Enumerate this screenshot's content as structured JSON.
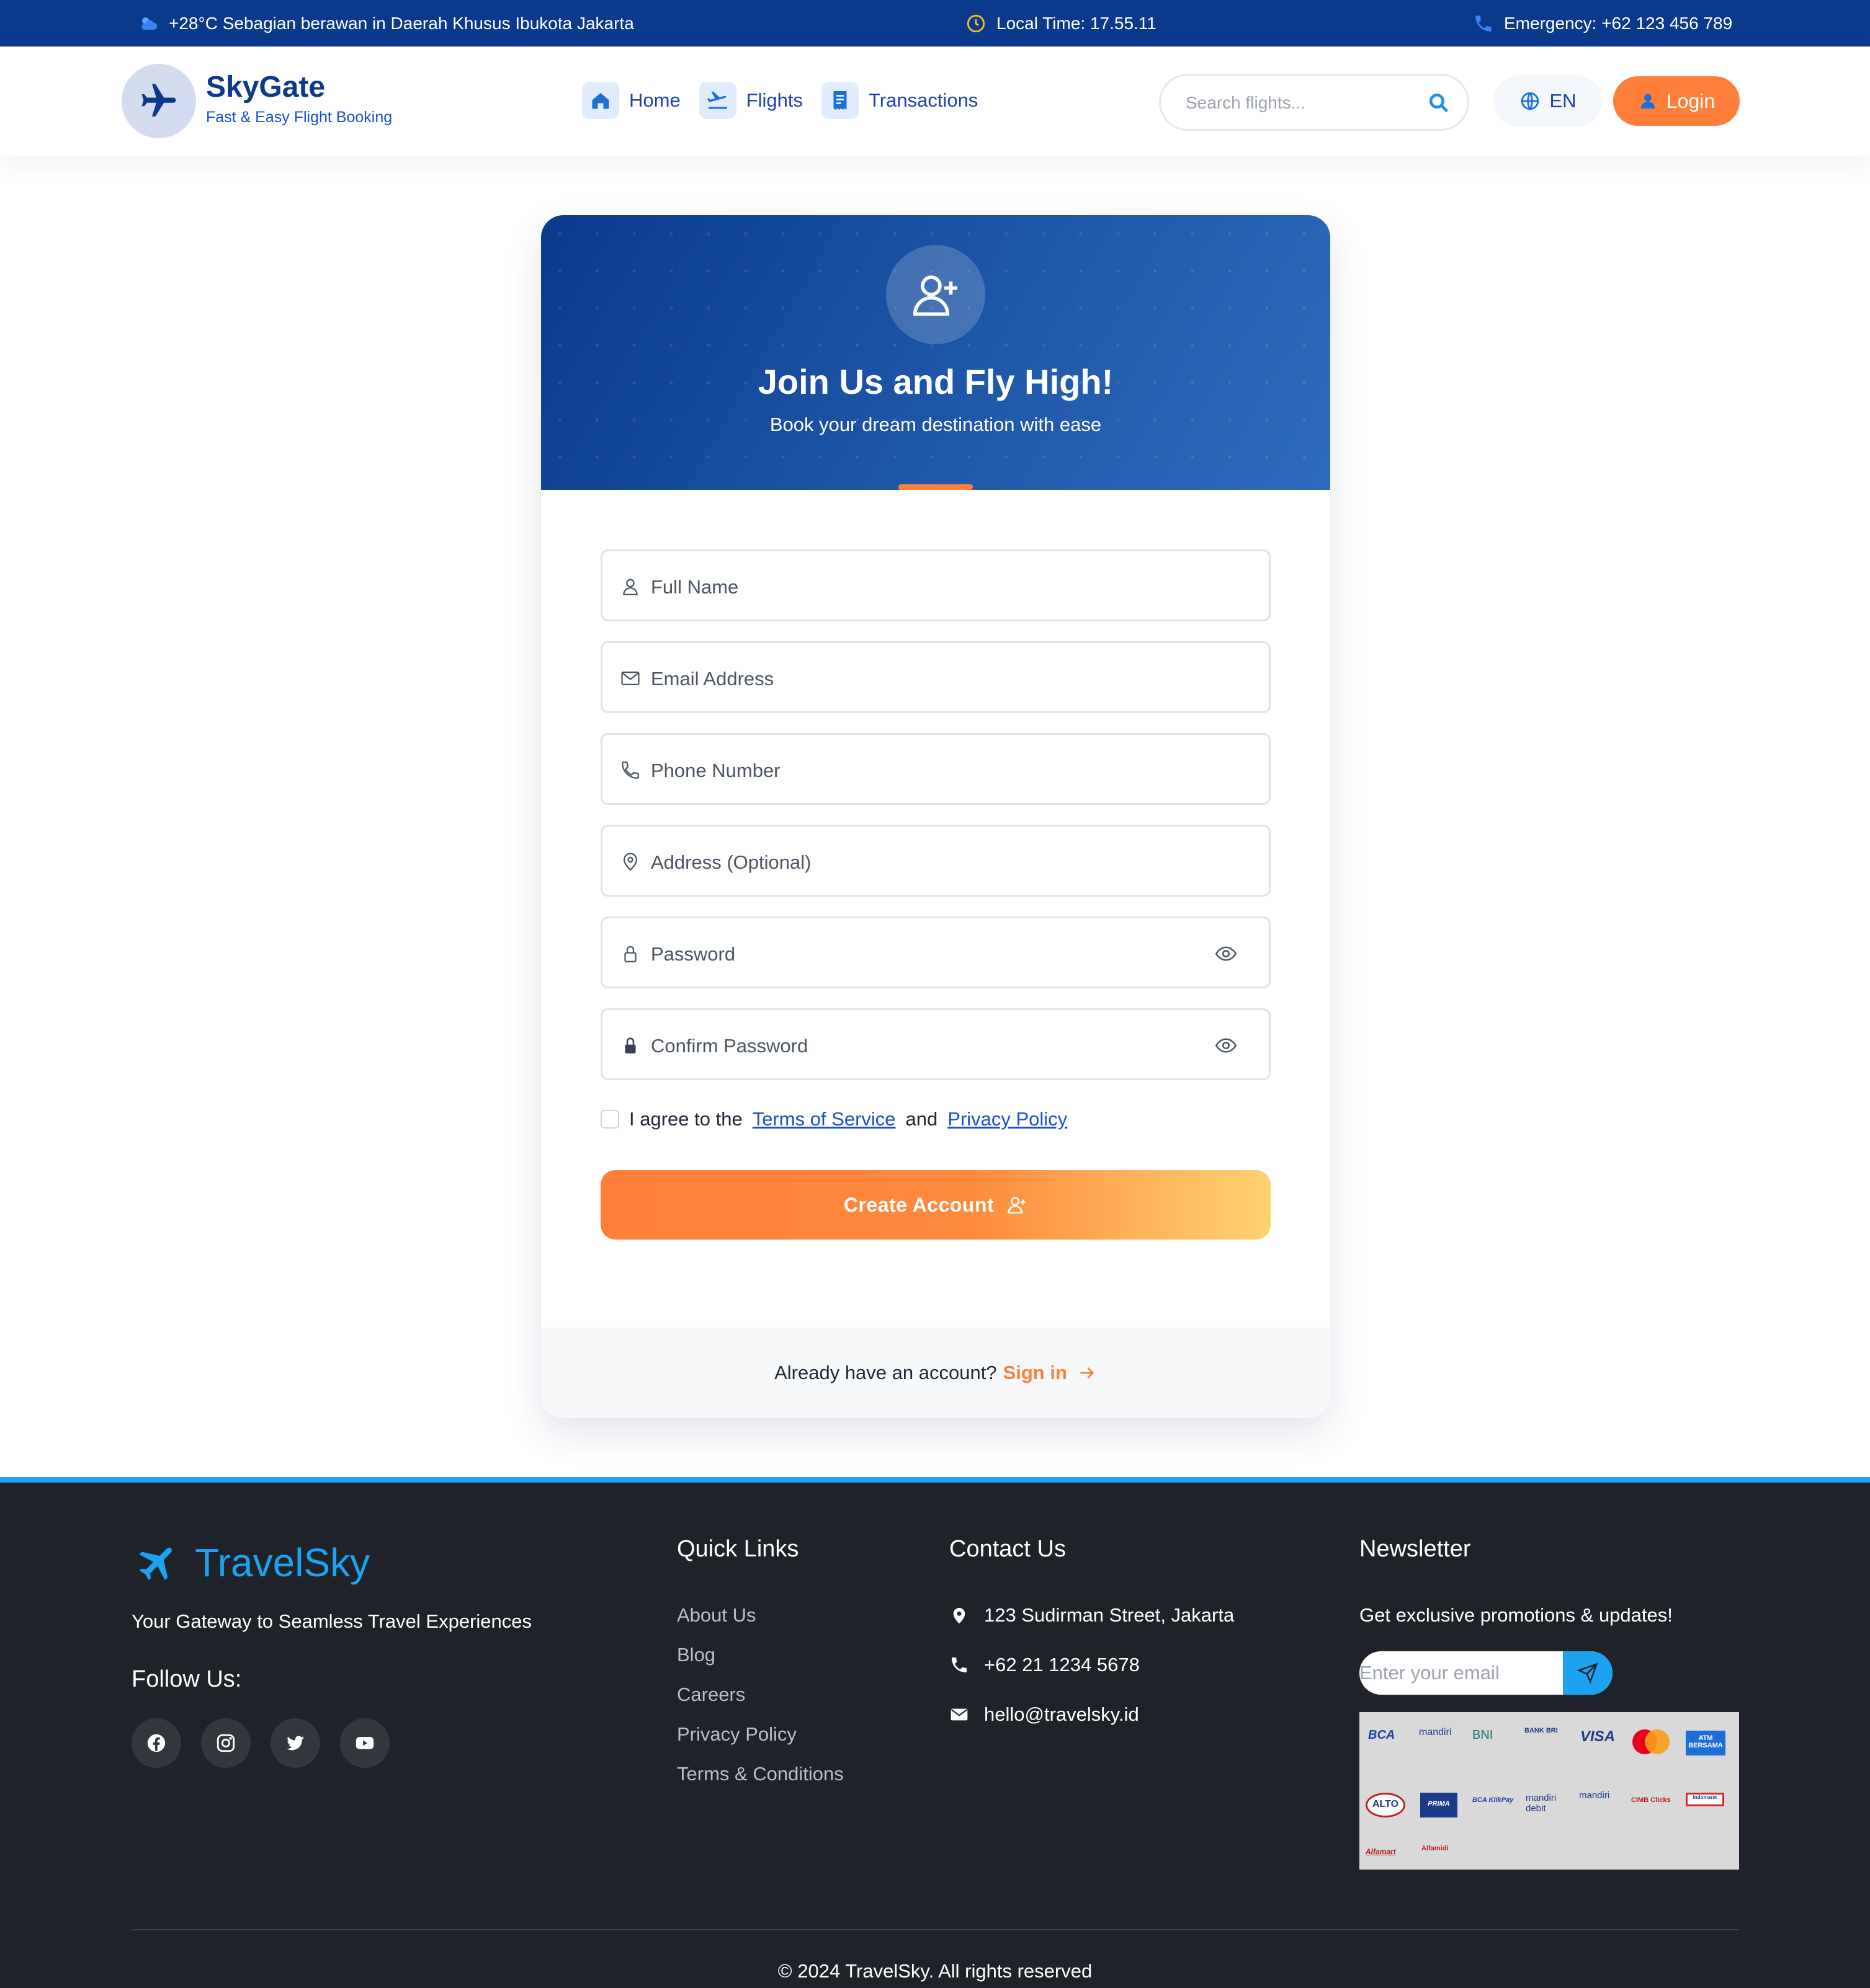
{
  "topbar": {
    "weather": "+28°C Sebagian berawan in Daerah Khusus Ibukota Jakarta",
    "time": "Local Time: 17.55.11",
    "emergency": "Emergency: +62 123 456 789"
  },
  "header": {
    "brand_name": "SkyGate",
    "brand_tagline": "Fast & Easy Flight Booking",
    "nav": [
      {
        "label": "Home",
        "icon": "home-icon"
      },
      {
        "label": "Flights",
        "icon": "plane-departure-icon"
      },
      {
        "label": "Transactions",
        "icon": "receipt-icon"
      }
    ],
    "search_placeholder": "Search flights...",
    "language": "EN",
    "login_label": "Login"
  },
  "register": {
    "title": "Join Us and Fly High!",
    "subtitle": "Book your dream destination with ease",
    "fields": {
      "full_name": "Full Name",
      "email": "Email Address",
      "phone": "Phone Number",
      "address": "Address (Optional)",
      "password": "Password",
      "confirm_password": "Confirm Password"
    },
    "agree_prefix": "I agree to the",
    "terms_link": "Terms of Service",
    "agree_and": "and",
    "privacy_link": "Privacy Policy",
    "create_button": "Create Account",
    "already_text": "Already have an account?",
    "signin_link": "Sign in"
  },
  "footer": {
    "brand_name": "TravelSky",
    "tagline": "Your Gateway to Seamless Travel Experiences",
    "follow_label": "Follow Us:",
    "quick_links_title": "Quick Links",
    "quick_links": [
      "About Us",
      "Blog",
      "Careers",
      "Privacy Policy",
      "Terms & Conditions"
    ],
    "contact_title": "Contact Us",
    "contact": {
      "address": "123 Sudirman Street, Jakarta",
      "phone": "+62 21 1234 5678",
      "email": "hello@travelsky.id"
    },
    "newsletter_title": "Newsletter",
    "newsletter_text": "Get exclusive promotions & updates!",
    "newsletter_placeholder": "Enter your email",
    "payment_logos": [
      "BCA",
      "mandiri",
      "BNI",
      "BANK BRI",
      "VISA",
      "mastercard",
      "ATM BERSAMA",
      "ALTO",
      "PRIMA",
      "BCA KlikPay",
      "mandiri debit",
      "mandiri",
      "CIMB Clicks",
      "Indomaret",
      "Alfamart",
      "Alfamidi"
    ],
    "copyright": "© 2024 TravelSky. All rights reserved"
  },
  "colors": {
    "primary_navy": "#0b3a8c",
    "accent_orange": "#ff7f3a",
    "footer_bg": "#1f2329",
    "footer_accent": "#1ba2f0"
  }
}
